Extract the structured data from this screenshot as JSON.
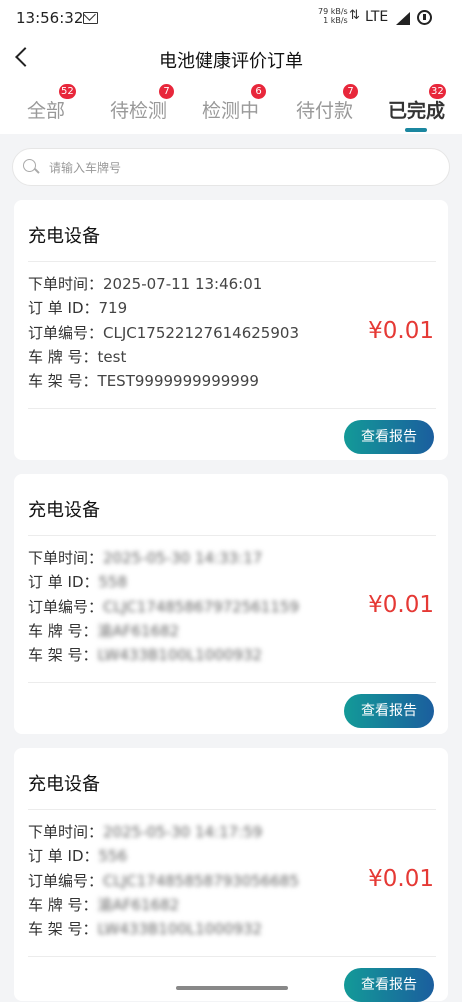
{
  "status_bar": {
    "time": "13:56:32",
    "speed_up": "79 kB/s",
    "speed_down": "1 kB/s",
    "network": "LTE",
    "icons": [
      "mail-icon",
      "data-arrows-icon",
      "signal-icon",
      "alert-icon"
    ]
  },
  "nav": {
    "title": "电池健康评价订单",
    "back_icon": "chevron-left-icon"
  },
  "tabs": [
    {
      "label": "全部",
      "badge": "52"
    },
    {
      "label": "待检测",
      "badge": "7"
    },
    {
      "label": "检测中",
      "badge": "6"
    },
    {
      "label": "待付款",
      "badge": "7"
    },
    {
      "label": "已完成",
      "badge": "32",
      "active": true
    }
  ],
  "search": {
    "placeholder": "请输入车牌号",
    "icon": "search-icon"
  },
  "labels": {
    "time": "下单时间：",
    "order_id": "订 单 ID：",
    "order_no": "订单编号：",
    "plate": "车 牌 号：",
    "vin": "车 架 号："
  },
  "orders": [
    {
      "title": "充电设备",
      "time": "2025-07-11 13:46:01",
      "order_id": "719",
      "order_no": "CLJC17522127614625903",
      "plate": "test",
      "vin": "TEST9999999999999",
      "price": "¥0.01",
      "button": "查看报告"
    },
    {
      "title": "充电设备",
      "time": "2025-05-30 14:33:17",
      "order_id": "558",
      "order_no": "CLJC17485867972561159",
      "plate": "渝AF61682",
      "vin": "LW433B100L1000932",
      "price": "¥0.01",
      "button": "查看报告"
    },
    {
      "title": "充电设备",
      "time": "2025-05-30 14:17:59",
      "order_id": "556",
      "order_no": "CLJC17485858793056685",
      "plate": "渝AF61682",
      "vin": "LW433B100L1000932",
      "price": "¥0.01",
      "button": "查看报告"
    }
  ],
  "colors": {
    "accent": "#1b87a0",
    "badge": "#e8273b",
    "price": "#e53935",
    "button_start": "#139a98",
    "button_end": "#1b5e9e"
  }
}
